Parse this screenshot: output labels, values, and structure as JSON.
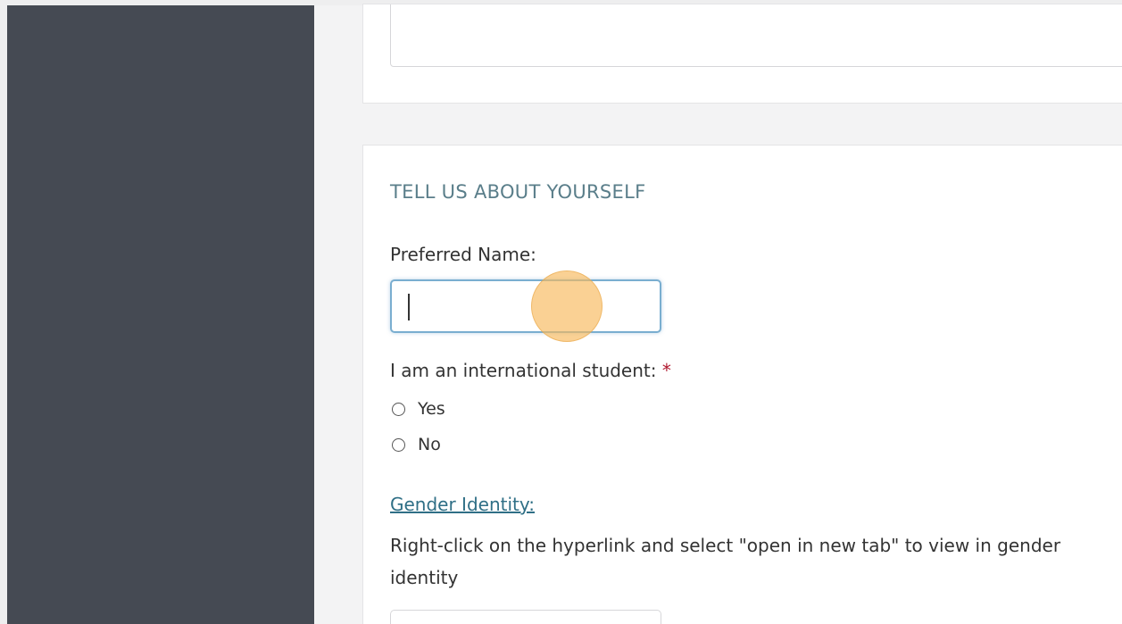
{
  "section": {
    "title": "TELL US ABOUT YOURSELF"
  },
  "preferred_name": {
    "label": "Preferred Name:",
    "value": ""
  },
  "international": {
    "label": "I am an international student:",
    "required_mark": "*",
    "options": [
      {
        "label": "Yes",
        "selected": false
      },
      {
        "label": "No",
        "selected": false
      }
    ]
  },
  "gender": {
    "link_text": "Gender Identity:",
    "help_text": "Right-click on the hyperlink and select \"open in new tab\" to view in gender identity"
  },
  "colors": {
    "sidebar": "#454a53",
    "section_title": "#5a7e8a",
    "link": "#2f6f86",
    "required": "#b0182f",
    "input_focus_border": "#7aaed0",
    "click_indicator": "#f7b95a"
  }
}
